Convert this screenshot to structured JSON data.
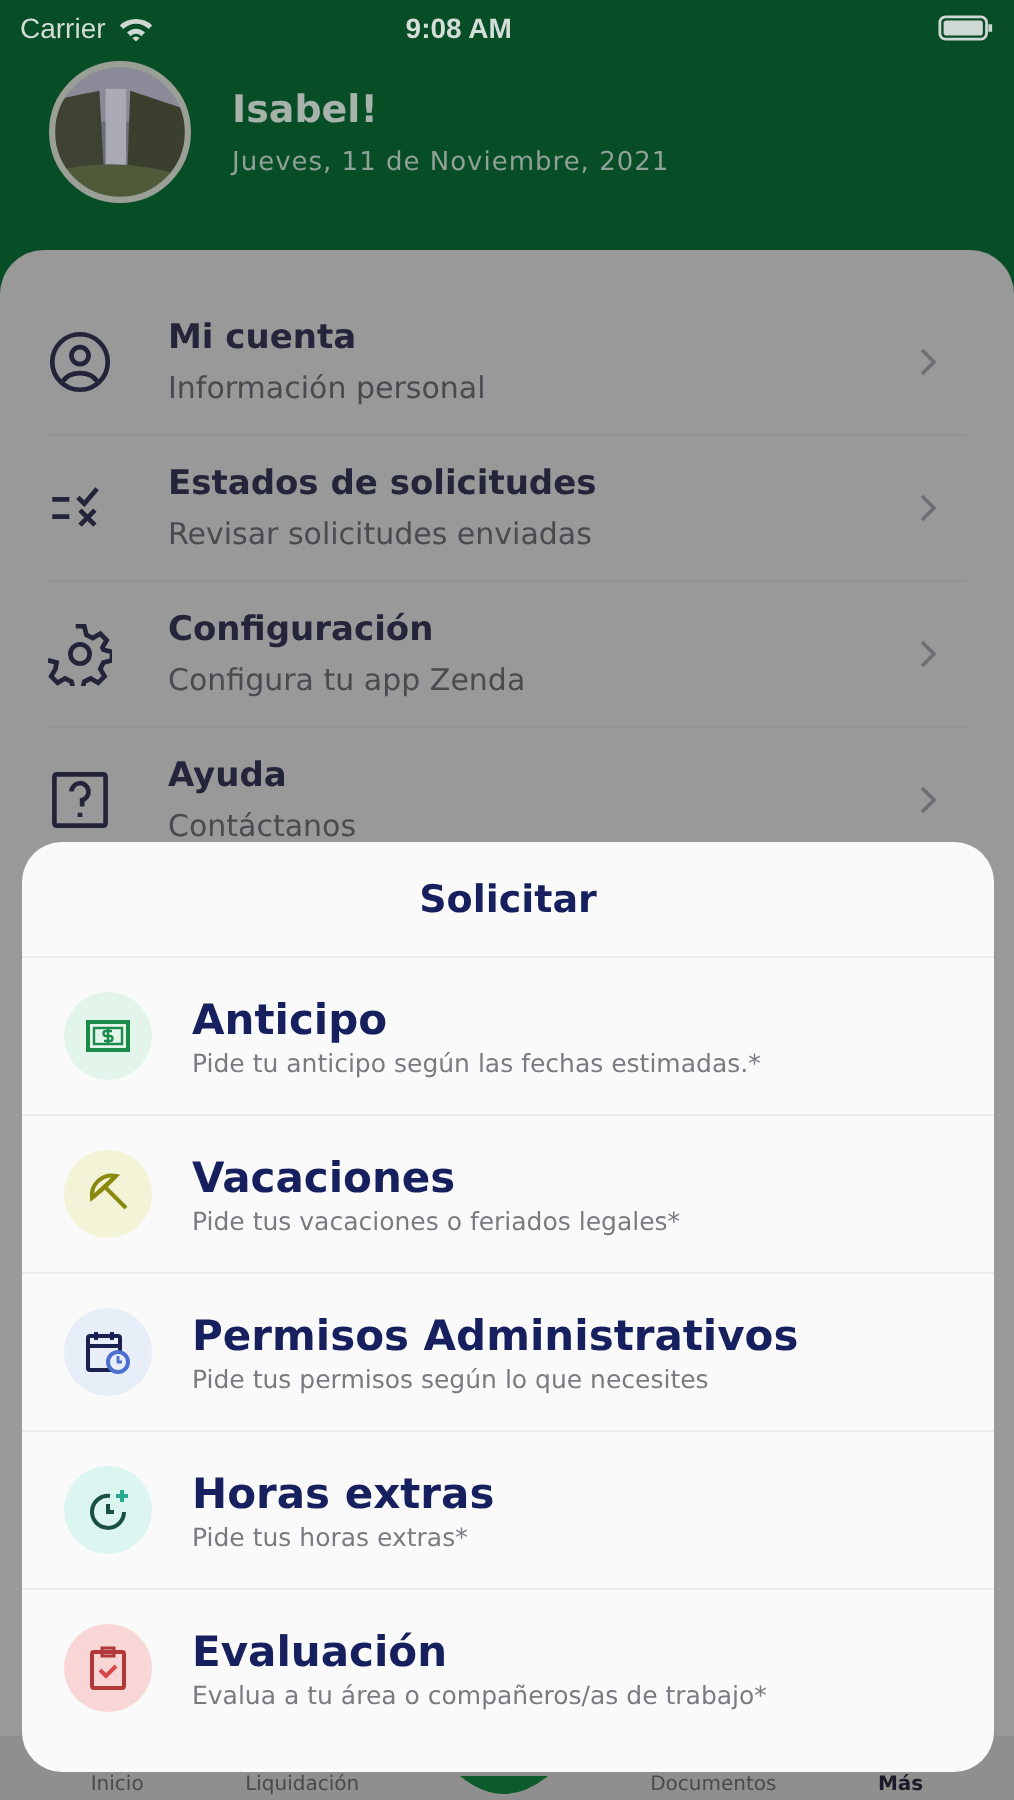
{
  "status_bar": {
    "carrier": "Carrier",
    "time": "9:08 AM"
  },
  "header": {
    "greeting": "Isabel!",
    "date": "Jueves, 11 de Noviembre, 2021"
  },
  "menu": [
    {
      "kind": "person",
      "title": "Mi cuenta",
      "subtitle": "Información personal"
    },
    {
      "kind": "status",
      "title": "Estados de solicitudes",
      "subtitle": "Revisar solicitudes enviadas"
    },
    {
      "kind": "gear",
      "title": "Configuración",
      "subtitle": "Configura tu app Zenda"
    },
    {
      "kind": "help",
      "title": "Ayuda",
      "subtitle": "Contáctanos"
    }
  ],
  "sheet": {
    "title": "Solicitar",
    "items": [
      {
        "kind": "money",
        "color": "#e3f5ea",
        "title": "Anticipo",
        "subtitle": "Pide tu anticipo según las fechas estimadas.*"
      },
      {
        "kind": "umbrella",
        "color": "#f3f3d8",
        "title": "Vacaciones",
        "subtitle": "Pide tus vacaciones o feriados legales*"
      },
      {
        "kind": "calendar",
        "color": "#e8eef7",
        "title": "Permisos Administrativos",
        "subtitle": "Pide tus permisos según lo que necesites"
      },
      {
        "kind": "clock",
        "color": "#dcf5f0",
        "title": "Horas extras",
        "subtitle": "Pide tus horas extras*"
      },
      {
        "kind": "clipboard",
        "color": "#f9d6d6",
        "title": "Evaluación",
        "subtitle": "Evalua a tu área o compañeros/as de trabajo*"
      }
    ]
  },
  "tab_bar": [
    {
      "label": "Inicio",
      "selected": false
    },
    {
      "label": "Liquidación",
      "selected": false
    },
    {
      "kind": "center"
    },
    {
      "label": "Documentos",
      "selected": false
    },
    {
      "label": "Más",
      "selected": true
    }
  ]
}
